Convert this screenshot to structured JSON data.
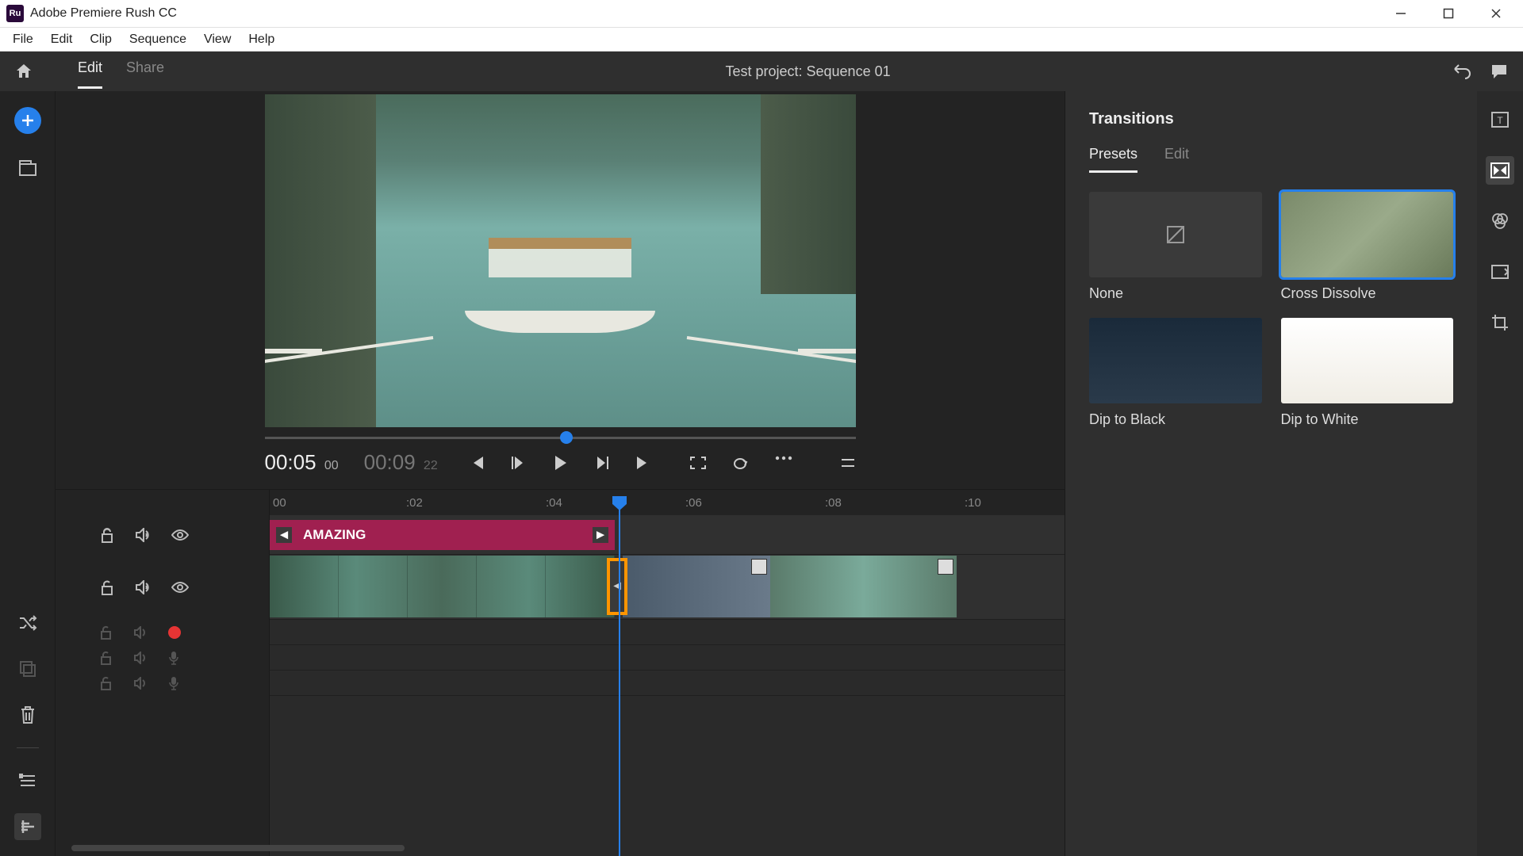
{
  "app": {
    "title": "Adobe Premiere Rush CC",
    "icon_label": "Ru"
  },
  "menubar": [
    "File",
    "Edit",
    "Clip",
    "Sequence",
    "View",
    "Help"
  ],
  "header": {
    "tabs": [
      "Edit",
      "Share"
    ],
    "active_tab": "Edit",
    "project_title": "Test project: Sequence 01"
  },
  "player": {
    "current_time": "00:05",
    "current_frames": "00",
    "total_time": "00:09",
    "total_frames": "22"
  },
  "ruler": {
    "marks": {
      "t0": "00",
      "t2": ":02",
      "t4": ":04",
      "t6": ":06",
      "t8": ":08",
      "t10": ":10"
    }
  },
  "timeline": {
    "title_clip_label": "AMAZING"
  },
  "transitions_panel": {
    "title": "Transitions",
    "tabs": [
      "Presets",
      "Edit"
    ],
    "active_tab": "Presets",
    "items": [
      {
        "label": "None"
      },
      {
        "label": "Cross Dissolve",
        "selected": true
      },
      {
        "label": "Dip to Black"
      },
      {
        "label": "Dip to White"
      }
    ]
  }
}
